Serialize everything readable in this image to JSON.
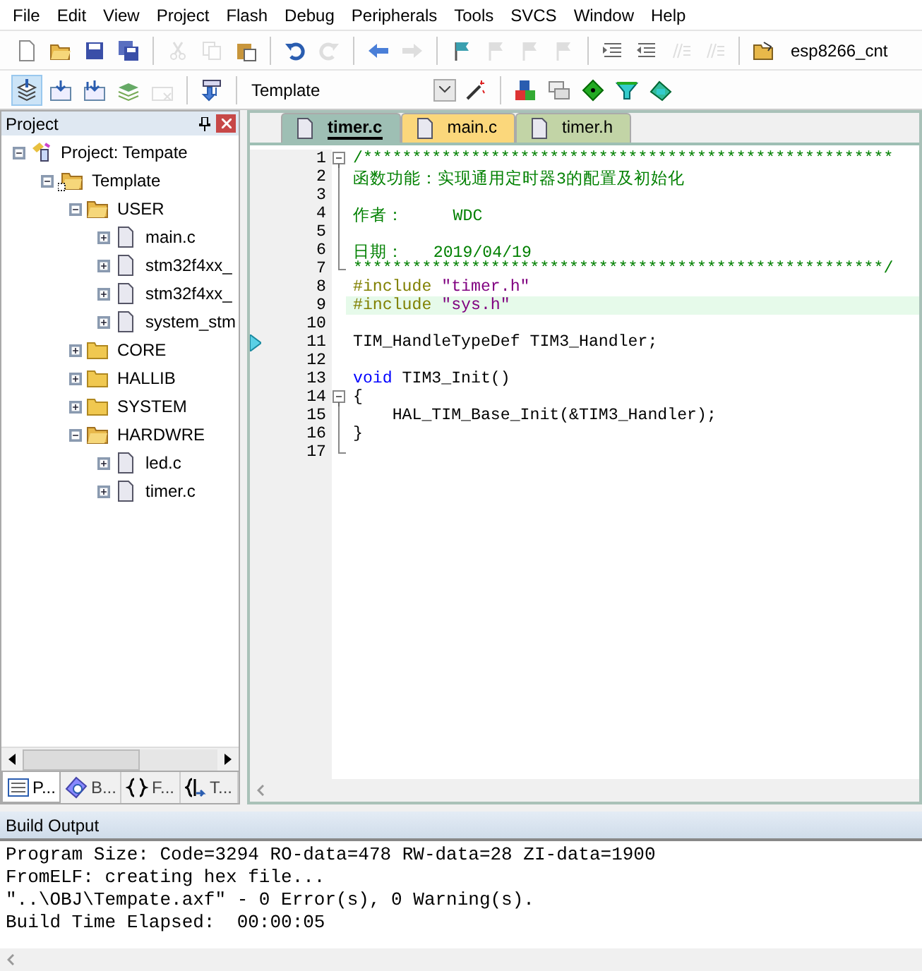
{
  "menu": [
    "File",
    "Edit",
    "View",
    "Project",
    "Flash",
    "Debug",
    "Peripherals",
    "Tools",
    "SVCS",
    "Window",
    "Help"
  ],
  "toolbar_1": {
    "buttons": [
      {
        "disabled": false
      },
      {
        "disabled": false
      },
      {
        "disabled": false
      },
      {
        "disabled": false
      },
      {
        "disabled": true
      },
      {
        "disabled": true
      },
      {
        "disabled": false
      },
      {
        "disabled": false
      },
      {
        "disabled": true
      },
      {
        "disabled": false
      },
      {
        "disabled": true
      },
      {
        "disabled": false
      },
      {
        "disabled": true
      },
      {
        "disabled": true
      },
      {
        "disabled": true
      },
      {
        "disabled": false
      },
      {
        "disabled": false
      },
      {
        "disabled": true
      },
      {
        "disabled": true
      }
    ],
    "find_text": "esp8266_cnt"
  },
  "toolbar_2": {
    "buttons": [
      {
        "pressed": true,
        "disabled": false
      },
      {
        "pressed": false,
        "disabled": false
      },
      {
        "pressed": false,
        "disabled": false
      },
      {
        "pressed": false,
        "disabled": false
      },
      {
        "pressed": false,
        "disabled": true
      },
      {
        "pressed": false,
        "disabled": false
      }
    ],
    "target": "Template"
  },
  "project_panel": {
    "title": "Project",
    "tree": [
      {
        "label": "Project: Tempate",
        "kind": "project",
        "expanded": true,
        "children": [
          {
            "label": "Template",
            "kind": "target",
            "expanded": true,
            "children": [
              {
                "label": "USER",
                "kind": "group",
                "expanded": true,
                "children": [
                  {
                    "label": "main.c",
                    "kind": "file",
                    "expanded": false
                  },
                  {
                    "label": "stm32f4xx_",
                    "kind": "file",
                    "expanded": false
                  },
                  {
                    "label": "stm32f4xx_",
                    "kind": "file",
                    "expanded": false
                  },
                  {
                    "label": "system_stm",
                    "kind": "file",
                    "expanded": false
                  }
                ]
              },
              {
                "label": "CORE",
                "kind": "group",
                "expanded": false
              },
              {
                "label": "HALLIB",
                "kind": "group",
                "expanded": false
              },
              {
                "label": "SYSTEM",
                "kind": "group",
                "expanded": false
              },
              {
                "label": "HARDWRE",
                "kind": "group",
                "expanded": true,
                "children": [
                  {
                    "label": "led.c",
                    "kind": "file",
                    "expanded": false
                  },
                  {
                    "label": "timer.c",
                    "kind": "file",
                    "expanded": false
                  }
                ]
              }
            ]
          }
        ]
      }
    ],
    "tabs": [
      {
        "label": "P...",
        "kind": "project",
        "selected": true
      },
      {
        "label": "B...",
        "kind": "books",
        "selected": false
      },
      {
        "label": "F...",
        "kind": "functions",
        "selected": false
      },
      {
        "label": "T...",
        "kind": "templates",
        "selected": false
      }
    ]
  },
  "editor": {
    "tabs": [
      {
        "label": "timer.c",
        "color": "#9ebfb4",
        "selected": true
      },
      {
        "label": "main.c",
        "color": "#fbd77b",
        "selected": false
      },
      {
        "label": "timer.h",
        "color": "#c2d4a6",
        "selected": false
      }
    ],
    "lines": [
      {
        "number": "1",
        "kind": "fold-start",
        "current": false,
        "marker": false,
        "segments": [
          {
            "kind": "comment",
            "text": "/******************************************************"
          }
        ]
      },
      {
        "number": "2",
        "kind": "fold-body",
        "current": false,
        "marker": false,
        "segments": [
          {
            "kind": "comment",
            "text": "函数功能：实现通用定时器3的配置及初始化"
          }
        ]
      },
      {
        "number": "3",
        "kind": "fold-body",
        "current": false,
        "marker": false
      },
      {
        "number": "4",
        "kind": "fold-body",
        "current": false,
        "marker": false,
        "segments": [
          {
            "kind": "comment",
            "text": "作者：     WDC"
          }
        ]
      },
      {
        "number": "5",
        "kind": "fold-body",
        "current": false,
        "marker": false
      },
      {
        "number": "6",
        "kind": "fold-body",
        "current": false,
        "marker": false,
        "segments": [
          {
            "kind": "comment",
            "text": "日期：   2019/04/19"
          }
        ]
      },
      {
        "number": "7",
        "kind": "fold-end",
        "current": false,
        "marker": false,
        "segments": [
          {
            "kind": "comment",
            "text": "******************************************************/"
          }
        ]
      },
      {
        "number": "8",
        "kind": "plain",
        "current": false,
        "marker": false,
        "segments": [
          {
            "kind": "preprocessor",
            "text": "#include "
          },
          {
            "kind": "string",
            "text": "\"timer.h\""
          }
        ]
      },
      {
        "number": "9",
        "kind": "plain",
        "current": true,
        "marker": false,
        "segments": [
          {
            "kind": "preprocessor",
            "text": "#include "
          },
          {
            "kind": "string",
            "text": "\"sys.h\""
          }
        ]
      },
      {
        "number": "10",
        "kind": "plain",
        "current": false,
        "marker": false
      },
      {
        "number": "11",
        "kind": "plain",
        "current": false,
        "marker": true,
        "segments": [
          {
            "kind": "plain",
            "text": "TIM_HandleTypeDef TIM3_Handler;"
          }
        ]
      },
      {
        "number": "12",
        "kind": "plain",
        "current": false,
        "marker": false
      },
      {
        "number": "13",
        "kind": "plain",
        "current": false,
        "marker": false,
        "segments": [
          {
            "kind": "keyword",
            "text": "void"
          },
          {
            "kind": "plain",
            "text": " TIM3_Init()"
          }
        ]
      },
      {
        "number": "14",
        "kind": "fold-start",
        "current": false,
        "marker": false,
        "segments": [
          {
            "kind": "plain",
            "text": "{"
          }
        ]
      },
      {
        "number": "15",
        "kind": "fold-body",
        "current": false,
        "marker": false,
        "segments": [
          {
            "kind": "plain",
            "text": "    HAL_TIM_Base_Init(&TIM3_Handler);"
          }
        ]
      },
      {
        "number": "16",
        "kind": "fold-body",
        "current": false,
        "marker": false,
        "segments": [
          {
            "kind": "plain",
            "text": "}"
          }
        ]
      },
      {
        "number": "17",
        "kind": "fold-end",
        "current": false,
        "marker": false
      }
    ]
  },
  "build_output": {
    "title": "Build Output",
    "lines": [
      "Program Size: Code=3294 RO-data=478 RW-data=28 ZI-data=1900",
      "FromELF: creating hex file...",
      "\"..\\OBJ\\Tempate.axf\" - 0 Error(s), 0 Warning(s).",
      "Build Time Elapsed:  00:00:05"
    ]
  }
}
